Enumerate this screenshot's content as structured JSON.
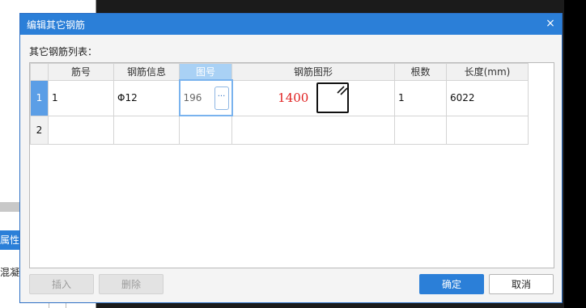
{
  "background": {
    "fragment_blue": "属性值",
    "fragment_text": "混凝土泵)"
  },
  "dialog": {
    "title": "编辑其它钢筋",
    "close_glyph": "×",
    "list_label": "其它钢筋列表："
  },
  "table": {
    "columns": [
      "筋号",
      "钢筋信息",
      "图号",
      "钢筋图形",
      "根数",
      "长度(mm)"
    ],
    "active_column": "图号",
    "rows": [
      {
        "row_num": "1",
        "bar_number": "1",
        "rebar_info": "Φ12",
        "figure_no": "196",
        "figure_value": "1400",
        "count": "1",
        "length": "6022"
      },
      {
        "row_num": "2",
        "bar_number": "",
        "rebar_info": "",
        "figure_no": "",
        "figure_value": "",
        "count": "",
        "length": ""
      }
    ],
    "ellipsis_label": "···"
  },
  "buttons": {
    "insert": "插入",
    "delete": "删除",
    "ok": "确定",
    "cancel": "取消"
  },
  "colors": {
    "titlebar": "#2b7fd8",
    "active_header": "#a9d1f5",
    "selected_row_header": "#5b9ee6",
    "figure_value": "#e02020"
  }
}
